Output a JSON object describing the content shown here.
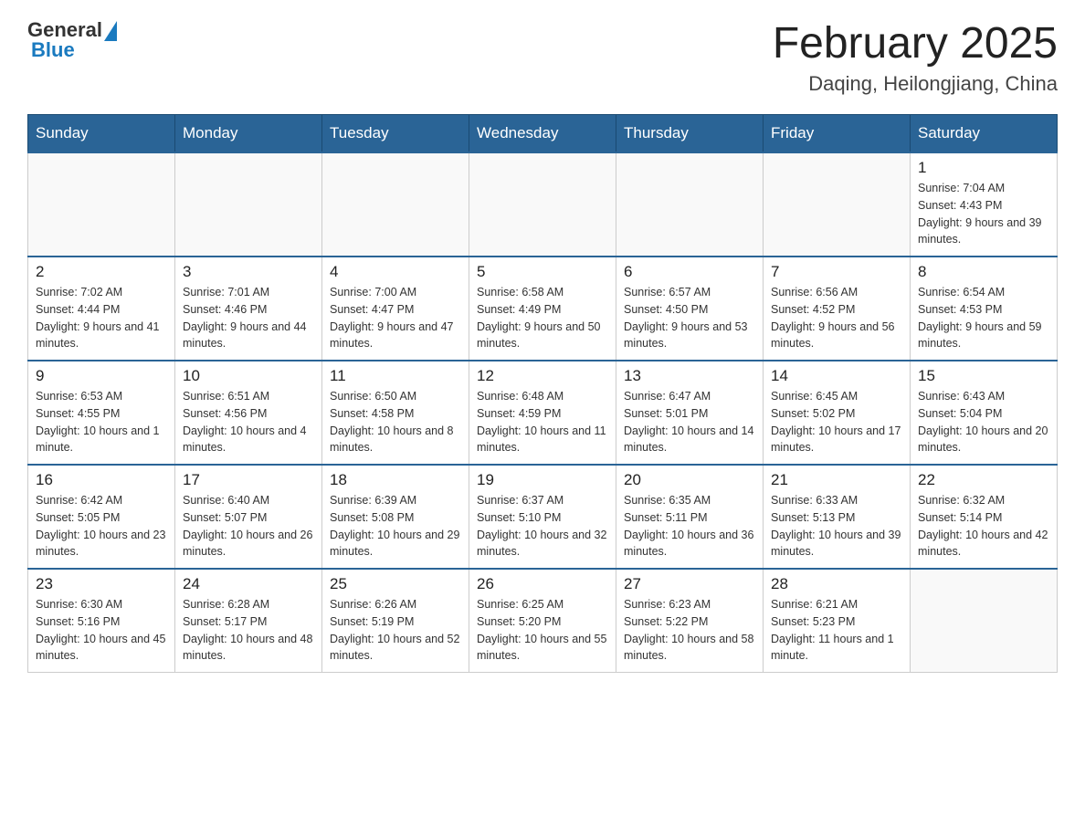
{
  "header": {
    "logo_general": "General",
    "logo_blue": "Blue",
    "title": "February 2025",
    "location": "Daqing, Heilongjiang, China"
  },
  "days_of_week": [
    "Sunday",
    "Monday",
    "Tuesday",
    "Wednesday",
    "Thursday",
    "Friday",
    "Saturday"
  ],
  "weeks": [
    [
      {
        "day": "",
        "info": ""
      },
      {
        "day": "",
        "info": ""
      },
      {
        "day": "",
        "info": ""
      },
      {
        "day": "",
        "info": ""
      },
      {
        "day": "",
        "info": ""
      },
      {
        "day": "",
        "info": ""
      },
      {
        "day": "1",
        "info": "Sunrise: 7:04 AM\nSunset: 4:43 PM\nDaylight: 9 hours and 39 minutes."
      }
    ],
    [
      {
        "day": "2",
        "info": "Sunrise: 7:02 AM\nSunset: 4:44 PM\nDaylight: 9 hours and 41 minutes."
      },
      {
        "day": "3",
        "info": "Sunrise: 7:01 AM\nSunset: 4:46 PM\nDaylight: 9 hours and 44 minutes."
      },
      {
        "day": "4",
        "info": "Sunrise: 7:00 AM\nSunset: 4:47 PM\nDaylight: 9 hours and 47 minutes."
      },
      {
        "day": "5",
        "info": "Sunrise: 6:58 AM\nSunset: 4:49 PM\nDaylight: 9 hours and 50 minutes."
      },
      {
        "day": "6",
        "info": "Sunrise: 6:57 AM\nSunset: 4:50 PM\nDaylight: 9 hours and 53 minutes."
      },
      {
        "day": "7",
        "info": "Sunrise: 6:56 AM\nSunset: 4:52 PM\nDaylight: 9 hours and 56 minutes."
      },
      {
        "day": "8",
        "info": "Sunrise: 6:54 AM\nSunset: 4:53 PM\nDaylight: 9 hours and 59 minutes."
      }
    ],
    [
      {
        "day": "9",
        "info": "Sunrise: 6:53 AM\nSunset: 4:55 PM\nDaylight: 10 hours and 1 minute."
      },
      {
        "day": "10",
        "info": "Sunrise: 6:51 AM\nSunset: 4:56 PM\nDaylight: 10 hours and 4 minutes."
      },
      {
        "day": "11",
        "info": "Sunrise: 6:50 AM\nSunset: 4:58 PM\nDaylight: 10 hours and 8 minutes."
      },
      {
        "day": "12",
        "info": "Sunrise: 6:48 AM\nSunset: 4:59 PM\nDaylight: 10 hours and 11 minutes."
      },
      {
        "day": "13",
        "info": "Sunrise: 6:47 AM\nSunset: 5:01 PM\nDaylight: 10 hours and 14 minutes."
      },
      {
        "day": "14",
        "info": "Sunrise: 6:45 AM\nSunset: 5:02 PM\nDaylight: 10 hours and 17 minutes."
      },
      {
        "day": "15",
        "info": "Sunrise: 6:43 AM\nSunset: 5:04 PM\nDaylight: 10 hours and 20 minutes."
      }
    ],
    [
      {
        "day": "16",
        "info": "Sunrise: 6:42 AM\nSunset: 5:05 PM\nDaylight: 10 hours and 23 minutes."
      },
      {
        "day": "17",
        "info": "Sunrise: 6:40 AM\nSunset: 5:07 PM\nDaylight: 10 hours and 26 minutes."
      },
      {
        "day": "18",
        "info": "Sunrise: 6:39 AM\nSunset: 5:08 PM\nDaylight: 10 hours and 29 minutes."
      },
      {
        "day": "19",
        "info": "Sunrise: 6:37 AM\nSunset: 5:10 PM\nDaylight: 10 hours and 32 minutes."
      },
      {
        "day": "20",
        "info": "Sunrise: 6:35 AM\nSunset: 5:11 PM\nDaylight: 10 hours and 36 minutes."
      },
      {
        "day": "21",
        "info": "Sunrise: 6:33 AM\nSunset: 5:13 PM\nDaylight: 10 hours and 39 minutes."
      },
      {
        "day": "22",
        "info": "Sunrise: 6:32 AM\nSunset: 5:14 PM\nDaylight: 10 hours and 42 minutes."
      }
    ],
    [
      {
        "day": "23",
        "info": "Sunrise: 6:30 AM\nSunset: 5:16 PM\nDaylight: 10 hours and 45 minutes."
      },
      {
        "day": "24",
        "info": "Sunrise: 6:28 AM\nSunset: 5:17 PM\nDaylight: 10 hours and 48 minutes."
      },
      {
        "day": "25",
        "info": "Sunrise: 6:26 AM\nSunset: 5:19 PM\nDaylight: 10 hours and 52 minutes."
      },
      {
        "day": "26",
        "info": "Sunrise: 6:25 AM\nSunset: 5:20 PM\nDaylight: 10 hours and 55 minutes."
      },
      {
        "day": "27",
        "info": "Sunrise: 6:23 AM\nSunset: 5:22 PM\nDaylight: 10 hours and 58 minutes."
      },
      {
        "day": "28",
        "info": "Sunrise: 6:21 AM\nSunset: 5:23 PM\nDaylight: 11 hours and 1 minute."
      },
      {
        "day": "",
        "info": ""
      }
    ]
  ]
}
